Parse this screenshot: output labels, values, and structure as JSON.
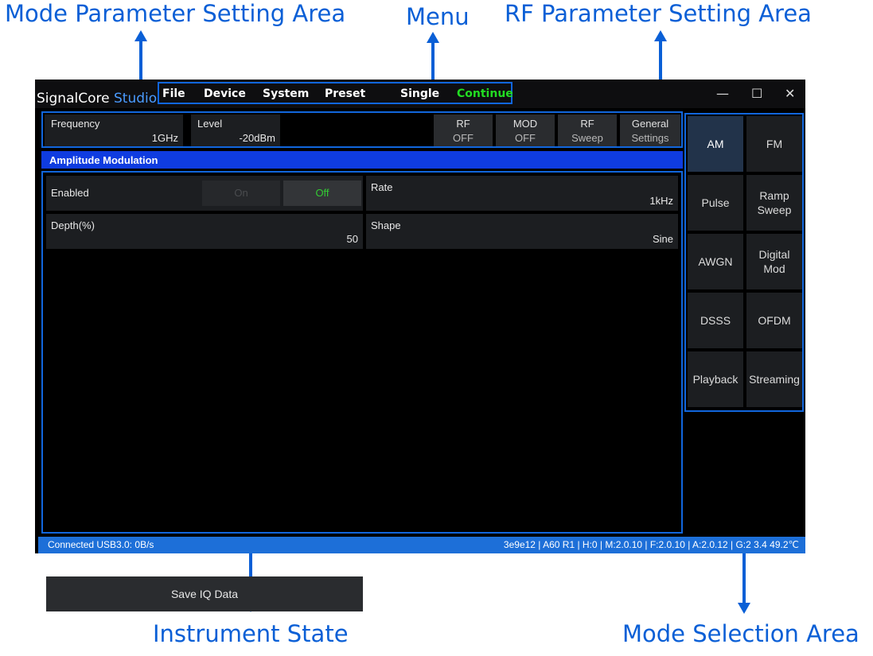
{
  "callouts": {
    "mode_param": "Mode Parameter Setting Area",
    "menu": "Menu",
    "rf_param": "RF Parameter Setting Area",
    "instrument_state": "Instrument State",
    "mode_selection": "Mode Selection Area"
  },
  "app": {
    "title_main": "SignalCore",
    "title_accent": "Studio"
  },
  "menu": {
    "file": "File",
    "device": "Device",
    "system": "System",
    "preset": "Preset",
    "single": "Single",
    "continue": "Continue"
  },
  "window_controls": {
    "minimize": "—",
    "maximize": "☐",
    "close": "✕"
  },
  "rf": {
    "frequency_label": "Frequency",
    "frequency_value": "1GHz",
    "level_label": "Level",
    "level_value": "-20dBm",
    "rf_btn": {
      "l1": "RF",
      "l2": "OFF"
    },
    "mod_btn": {
      "l1": "MOD",
      "l2": "OFF"
    },
    "sweep_btn": {
      "l1": "RF",
      "l2": "Sweep"
    },
    "general_btn": {
      "l1": "General",
      "l2": "Settings"
    }
  },
  "section_title": "Amplitude Modulation",
  "params": {
    "enabled_label": "Enabled",
    "on_label": "On",
    "off_label": "Off",
    "rate_label": "Rate",
    "rate_value": "1kHz",
    "depth_label": "Depth(%)",
    "depth_value": "50",
    "shape_label": "Shape",
    "shape_value": "Sine",
    "save_iq": "Save IQ Data"
  },
  "modes": [
    {
      "label": "AM",
      "active": true
    },
    {
      "label": "FM"
    },
    {
      "label": "Pulse"
    },
    {
      "label": "Ramp Sweep"
    },
    {
      "label": "AWGN"
    },
    {
      "label": "Digital Mod"
    },
    {
      "label": "DSSS"
    },
    {
      "label": "OFDM"
    },
    {
      "label": "Playback"
    },
    {
      "label": "Streaming"
    }
  ],
  "status": {
    "left": "Connected USB3.0: 0B/s",
    "right": "3e9e12 | A60 R1 | H:0 | M:2.0.10 | F:2.0.10 | A:2.0.12 | G:2 3.4  49.2℃"
  },
  "colors": {
    "accent_blue": "#1166dd",
    "status_bar": "#1d6fd8",
    "section_bar": "#0f3ce0",
    "continue_green": "#22dd22",
    "off_green": "#33cc33"
  }
}
